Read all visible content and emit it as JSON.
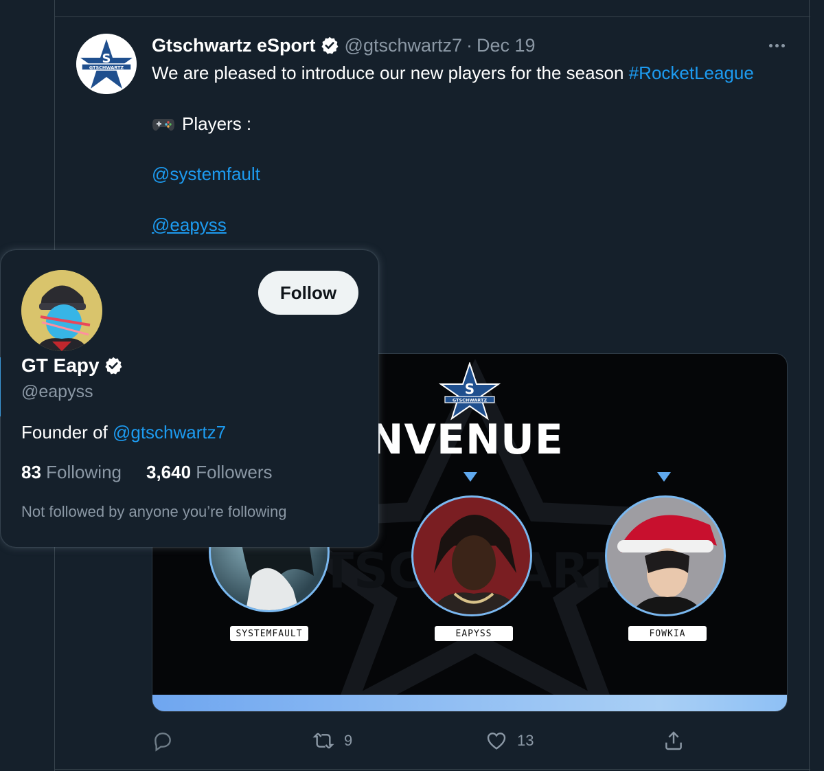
{
  "tweet": {
    "author_name": "Gtschwartz eSport",
    "author_handle": "@gtschwartz7",
    "separator": "·",
    "date": "Dec 19",
    "text_intro": "We are pleased to introduce our new players for the season ",
    "hashtag": "#RocketLeague",
    "players_label": "Players :",
    "mention_1": "@systemfault",
    "mention_2": "@eapyss",
    "avatar_logo_text": "GTSCHWARTZ"
  },
  "media": {
    "title": "IENVENUE",
    "logo_text": "GTSCHWARTZ",
    "players": [
      "SYSTEMFAULT",
      "EAPYSS",
      "FOWKIA"
    ]
  },
  "actions": {
    "reply_count": "",
    "retweet_count": "9",
    "like_count": "13"
  },
  "hover_card": {
    "follow_label": "Follow",
    "name": "GT Eapy",
    "handle": "@eapyss",
    "bio_prefix": "Founder of ",
    "bio_mention": "@gtschwartz7",
    "following_count": "83",
    "following_label": "Following",
    "followers_count": "3,640",
    "followers_label": "Followers",
    "note": "Not followed by anyone you’re following"
  },
  "colors": {
    "background": "#15202b",
    "link": "#1d9bf0",
    "secondary_text": "#8b98a5",
    "border": "#38444d"
  }
}
